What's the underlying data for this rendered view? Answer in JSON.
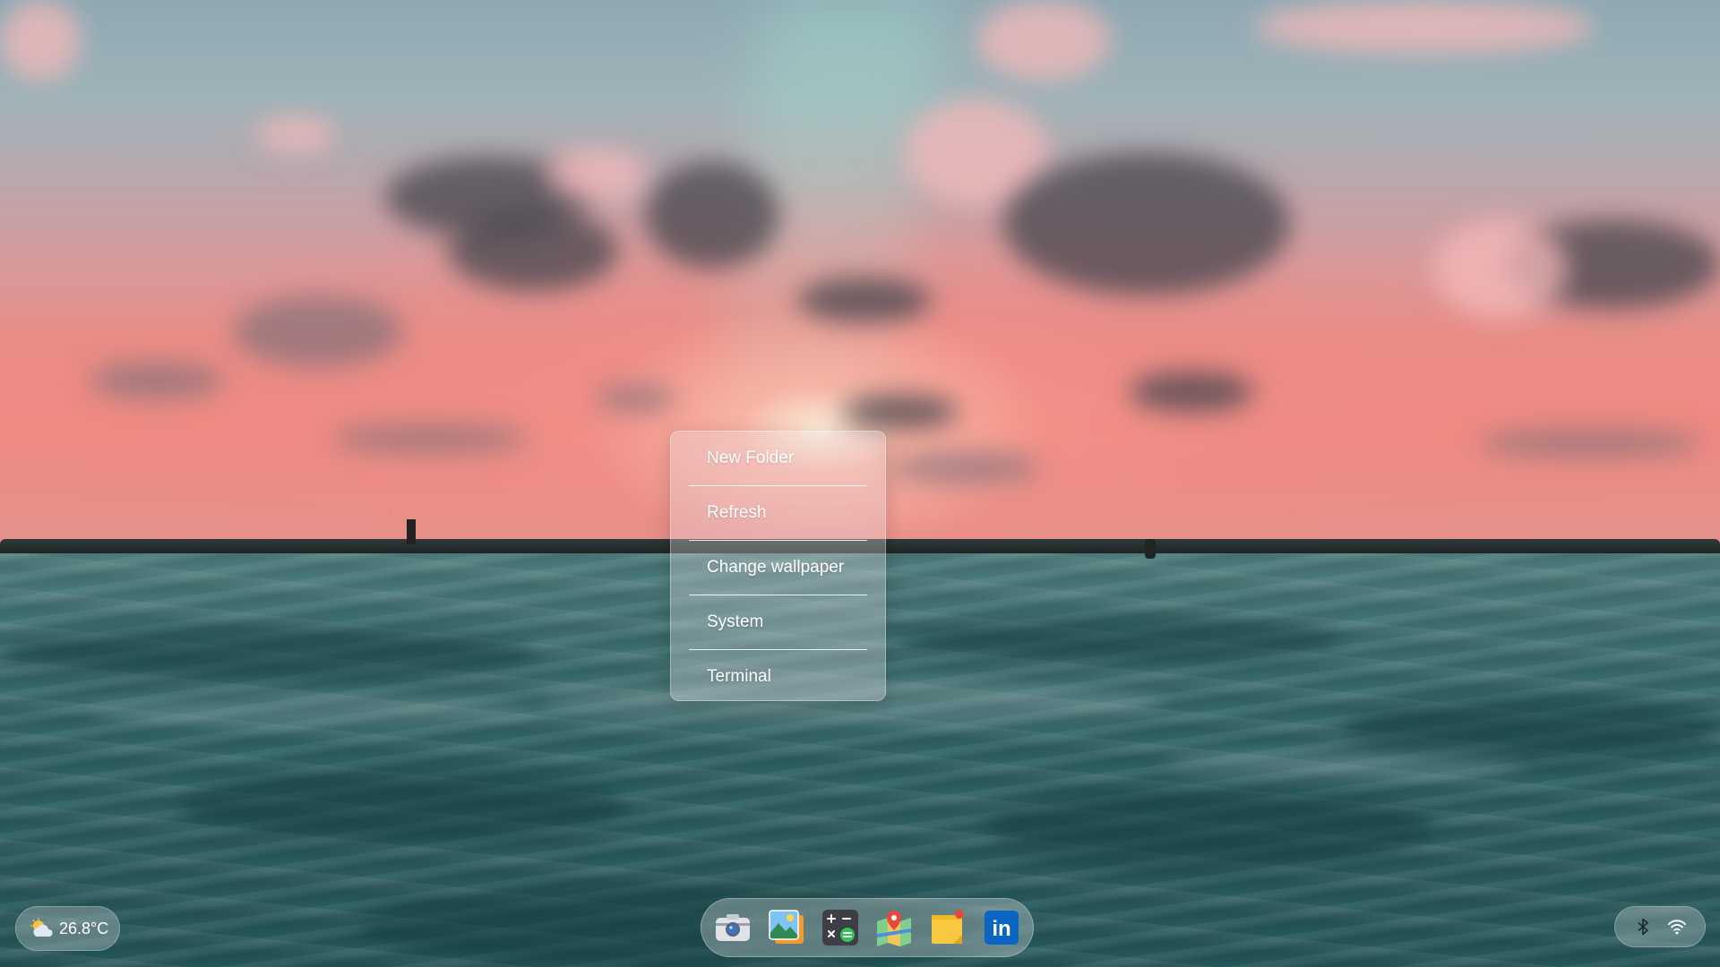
{
  "wallpaper": {
    "description_colors": {
      "sky_top": "#8fa9b3",
      "sky_glow": "#ee8a82",
      "sea": "#2f6466"
    }
  },
  "context_menu": {
    "items": [
      {
        "label": "New Folder"
      },
      {
        "label": "Refresh"
      },
      {
        "label": "Change wallpaper"
      },
      {
        "label": "System"
      },
      {
        "label": "Terminal"
      }
    ]
  },
  "weather": {
    "temperature": "26.8°C",
    "icon": "partly-cloudy-icon"
  },
  "dock": {
    "apps": [
      {
        "name": "camera-app",
        "icon": "camera-icon"
      },
      {
        "name": "photos-app",
        "icon": "photos-icon"
      },
      {
        "name": "calculator-app",
        "icon": "calculator-icon"
      },
      {
        "name": "maps-app",
        "icon": "maps-icon"
      },
      {
        "name": "notes-app",
        "icon": "sticky-notes-icon"
      },
      {
        "name": "linkedin-app",
        "icon": "linkedin-icon",
        "label": "in"
      }
    ]
  },
  "tray": {
    "icons": [
      "bluetooth-icon",
      "wifi-icon"
    ]
  }
}
